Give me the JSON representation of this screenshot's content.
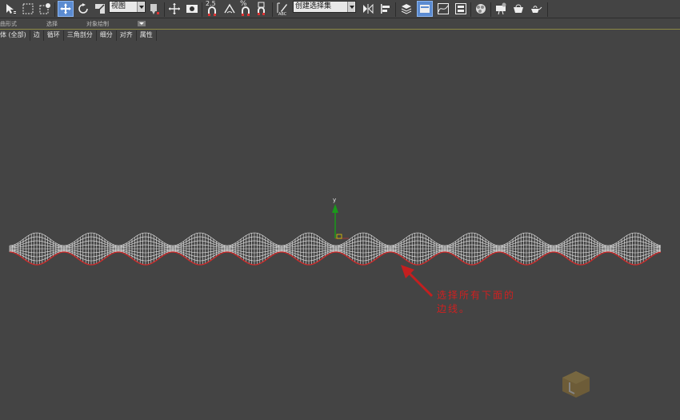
{
  "toolbar": {
    "view_combo": "视图",
    "snap_angle": "2.5",
    "percent_label": "%",
    "selection_set_combo": "创建选择集",
    "colors": {
      "active": "#5b8bd1",
      "bg": "#444444"
    }
  },
  "ribbon": {
    "tab_labels": [
      "曲形式",
      "选择",
      "对象绘制"
    ],
    "modeling_tabs": [
      "体 (全部)",
      "边",
      "循环",
      "三角剖分",
      "细分",
      "对齐",
      "属性"
    ]
  },
  "viewport": {
    "gizmo_axis_label": "y",
    "annotation_line1": "选择所有下面的",
    "annotation_line2": "边线。",
    "colors": {
      "wire": "#e8e8e8",
      "selected_edge": "#d12a2a",
      "gizmo_y": "#1a9a1a"
    }
  },
  "icons": [
    "select-object-icon",
    "rectangle-select-icon",
    "window-crossing-icon",
    "move-icon",
    "rotate-icon",
    "scale-icon",
    "pivot-icon",
    "snap-icon",
    "angle-snap-icon",
    "percent-snap-icon",
    "spinner-snap-icon",
    "edit-named-selection-icon",
    "mirror-icon",
    "align-icon",
    "layer-icon",
    "ribbon-toggle-icon",
    "curve-editor-icon",
    "schematic-view-icon",
    "material-editor-icon",
    "render-setup-icon",
    "render-frame-icon",
    "render-icon"
  ]
}
